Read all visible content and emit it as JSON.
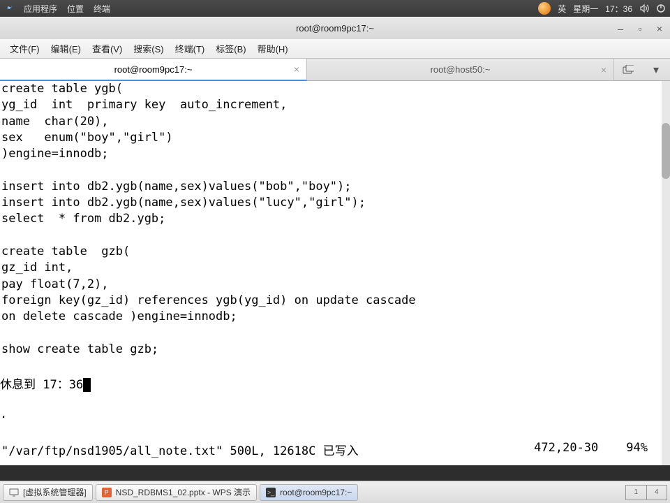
{
  "sysbar": {
    "apps": "应用程序",
    "places": "位置",
    "terminal": "终端",
    "ime": "英",
    "day": "星期一",
    "time": "17：36"
  },
  "titlebar": {
    "title": "root@room9pc17:~"
  },
  "menu": {
    "file": "文件(F)",
    "edit": "编辑(E)",
    "view": "查看(V)",
    "search": "搜索(S)",
    "terminal": "终端(T)",
    "tabs": "标签(B)",
    "help": "帮助(H)"
  },
  "tabs": {
    "t1": "root@room9pc17:~",
    "t2": "root@host50:~"
  },
  "termlines": [
    "create table ygb(",
    "yg_id  int  primary key  auto_increment,",
    "name  char(20),",
    "sex   enum(\"boy\",\"girl\")",
    ")engine=innodb;",
    "",
    "insert into db2.ygb(name,sex)values(\"bob\",\"boy\");",
    "insert into db2.ygb(name,sex)values(\"lucy\",\"girl\");",
    "select  * from db2.ygb;",
    "",
    "create table  gzb(",
    "gz_id int,",
    "pay float(7,2),",
    "foreign key(gz_id) references ygb(yg_id) on update cascade ",
    "on delete cascade )engine=innodb;",
    "",
    "show create table gzb;",
    ""
  ],
  "break_prefix": "                休息到 17：36",
  "break_dot": "              .",
  "status": {
    "file": "\"/var/ftp/nsd1905/all_note.txt\" 500L, 12618C 已写入",
    "pos": "472,20-30",
    "pct": "94%"
  },
  "taskbar": {
    "vm": "[虚拟系统管理器]",
    "wps": "NSD_RDBMS1_02.pptx - WPS 演示",
    "term": "root@room9pc17:~",
    "pager_l": "1",
    "pager_r": "4"
  }
}
